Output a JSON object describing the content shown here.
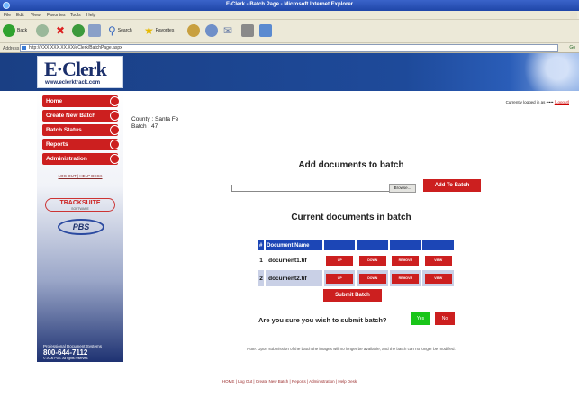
{
  "window": {
    "title": "E-Clerk - Batch Page - Microsoft Internet Explorer"
  },
  "menu": [
    "File",
    "Edit",
    "View",
    "Favorites",
    "Tools",
    "Help"
  ],
  "toolbar": {
    "back": "Back",
    "search": "Search",
    "favorites": "Favorites"
  },
  "address": {
    "label": "Address",
    "url": "http://XXX.XXX.XX.XX/eClerk/BatchPage.aspx",
    "go": "Go"
  },
  "logo": {
    "brand": "E·Clerk",
    "url": "www.eclerktrack.com"
  },
  "nav": [
    "Home",
    "Create New Batch",
    "Batch Status",
    "Reports",
    "Administration"
  ],
  "sidebar": {
    "links": "LOG OUT | HELP DESK",
    "tracksuite": "TRACKSUITE",
    "tracksuite_sub": "SOFTWARE",
    "pbs": "PBS",
    "footer_line1": "Professional Document Systems",
    "phone": "800-644-7112",
    "footer_line3": "© 2006 PDS. All rights reserved."
  },
  "header": {
    "logged_in": "Currently logged in as •••••",
    "logout_link": "[Logout]"
  },
  "batch": {
    "county": "County : Santa Fe",
    "batch": "Batch : 47"
  },
  "add_section": {
    "heading": "Add documents to batch",
    "browse": "Browse...",
    "add_button": "Add To Batch"
  },
  "current_section": {
    "heading": "Current documents in batch",
    "columns": {
      "num": "#",
      "name": "Document Name"
    },
    "rows": [
      {
        "num": "1",
        "name": "document1.tif"
      },
      {
        "num": "2",
        "name": "document2.tif"
      }
    ],
    "actions": {
      "up": "UP",
      "down": "DOWN",
      "remove": "REMOVE",
      "view": "VIEW"
    }
  },
  "submit": {
    "button": "Submit Batch",
    "question": "Are you sure you wish to submit batch?",
    "yes": "Yes",
    "no": "No"
  },
  "note": "Note: Upon submission of the batch the images will no longer be available, and the batch can no longer be modified.",
  "footer_links": "HOME | Log Out | Create New Batch | Reports | Administration | Help Desk",
  "colors": {
    "accent_red": "#cc1f1f",
    "header_blue": "#1a3f84",
    "table_blue": "#1c46b6",
    "yes_green": "#19c519"
  }
}
